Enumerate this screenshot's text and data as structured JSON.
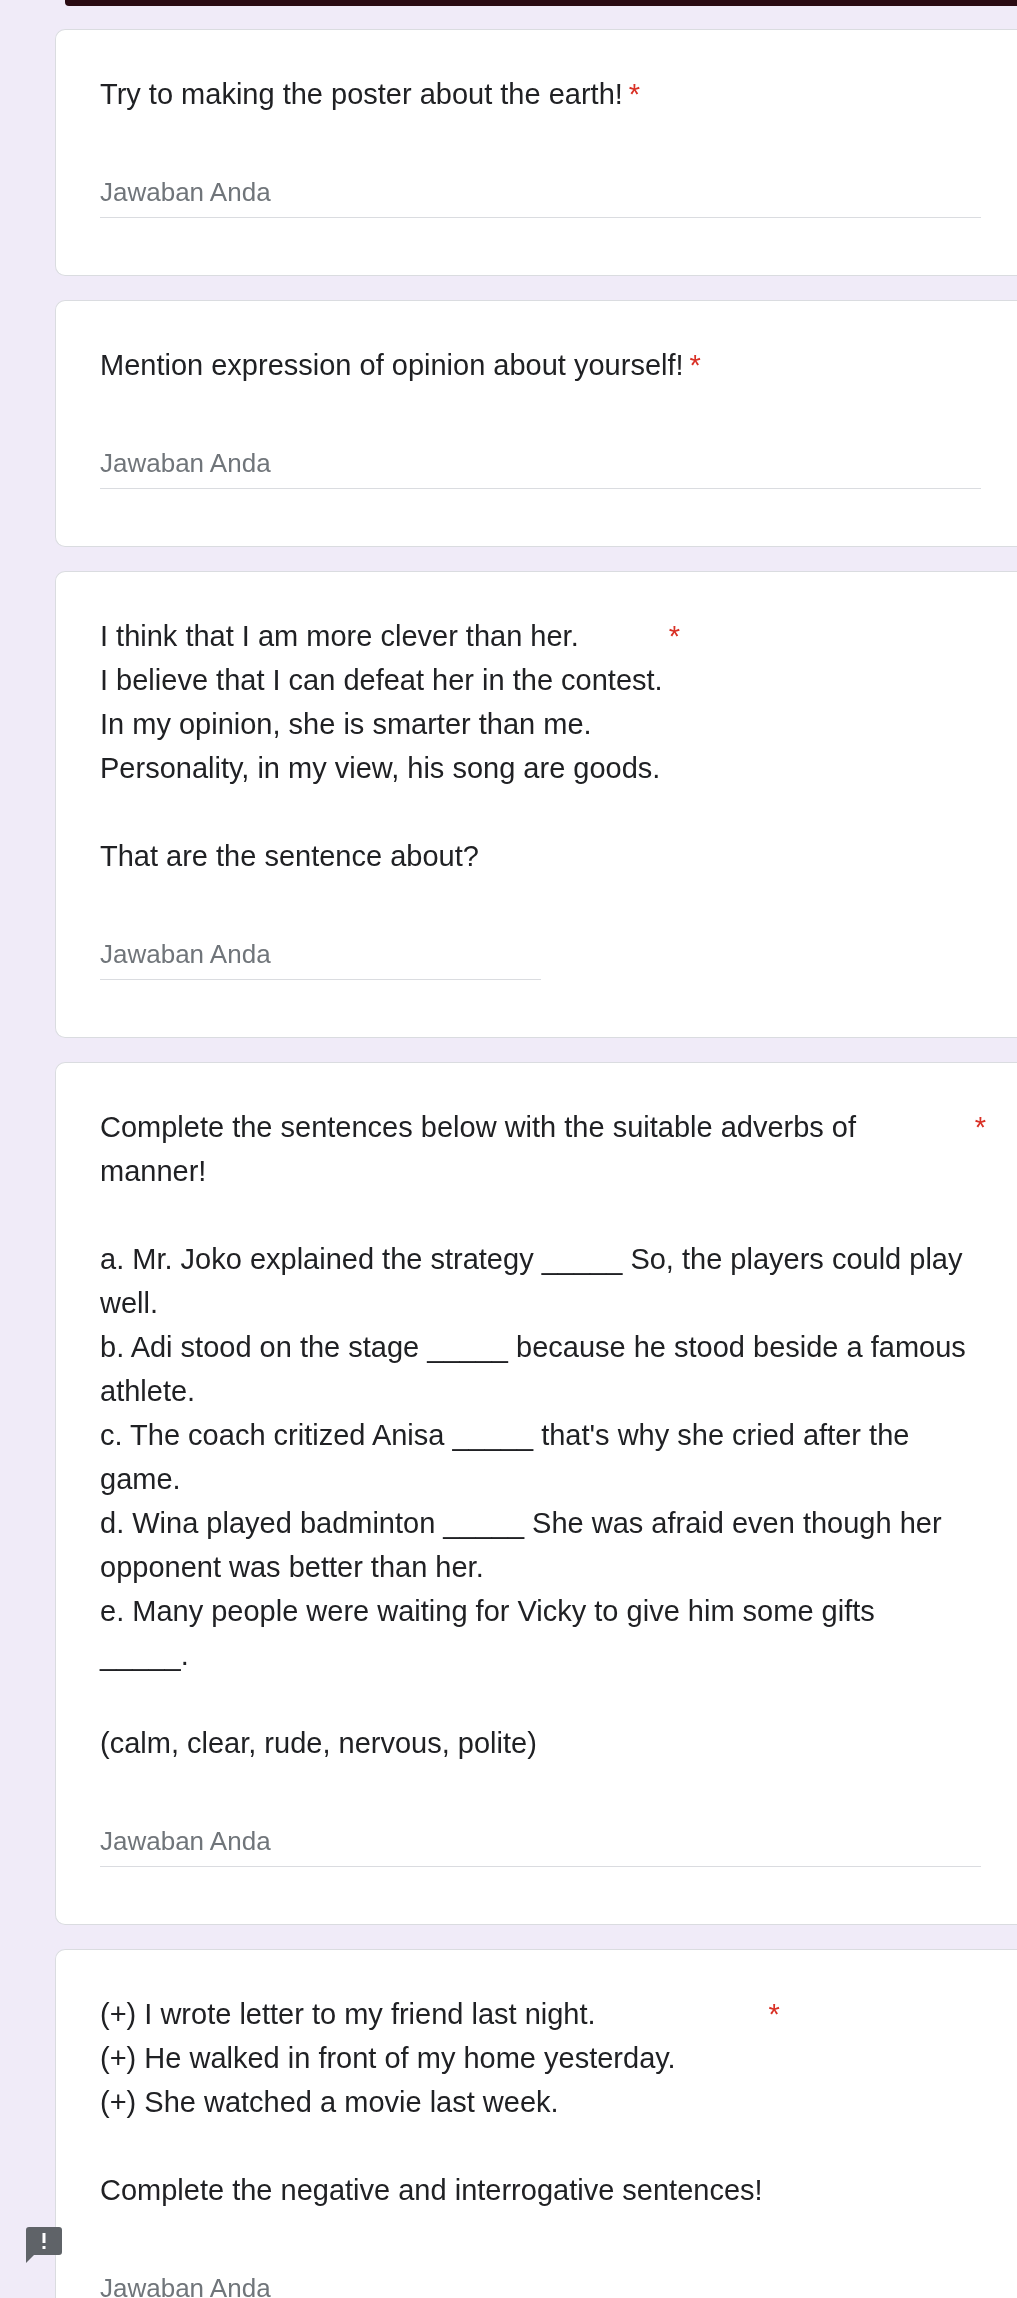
{
  "questions": [
    {
      "paragraphs": [
        [
          "Try to making the poster about the earth!"
        ]
      ],
      "required_mark": "*",
      "answer": {
        "kind": "paragraph",
        "placeholder": "Jawaban Anda"
      }
    },
    {
      "paragraphs": [
        [
          "Mention expression of opinion about yourself!"
        ]
      ],
      "required_mark": "*",
      "answer": {
        "kind": "paragraph",
        "placeholder": "Jawaban Anda"
      }
    },
    {
      "paragraphs": [
        [
          "I think that I am more clever than her.",
          "I believe that I can defeat her in the contest.",
          "In my opinion, she is smarter than me.",
          "Personality, in my view, his song are goods."
        ],
        [
          "That are the sentence about?"
        ]
      ],
      "required_mark": "*",
      "answer": {
        "kind": "short",
        "placeholder": "Jawaban Anda"
      }
    },
    {
      "paragraphs": [
        [
          "Complete the sentences below with the suitable adverbs of manner!"
        ],
        [
          "a. Mr. Joko explained the strategy _____ So, the players could play well.",
          "b. Adi stood on the stage _____ because he stood beside a famous athlete.",
          "c. The coach critized Anisa _____ that's why she cried after the game.",
          "d. Wina played badminton _____ She was afraid even though her opponent was better than her.",
          "e. Many people were waiting for Vicky to give him some gifts _____."
        ],
        [
          "(calm, clear, rude, nervous, polite)"
        ]
      ],
      "required_mark": "*",
      "answer": {
        "kind": "paragraph",
        "placeholder": "Jawaban Anda"
      }
    },
    {
      "paragraphs": [
        [
          "(+) I wrote letter to my friend last night.",
          "(+) He walked in front of my home yesterday.",
          "(+) She watched a movie last week."
        ],
        [
          "Complete the negative and interrogative sentences!"
        ]
      ],
      "required_mark": "*",
      "answer": {
        "placeholder": "Jawaban Anda"
      }
    }
  ]
}
